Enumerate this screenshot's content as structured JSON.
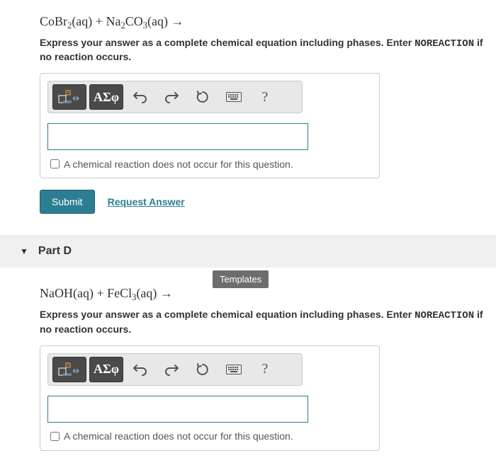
{
  "partC": {
    "equation_html": "CoBr<sub>2</sub>(aq) + Na<sub>2</sub>CO<sub>3</sub>(aq) →",
    "instruction_prefix": "Express your answer as a complete chemical equation including phases. Enter ",
    "instruction_mono": "NOREACTION",
    "instruction_suffix": " if no reaction occurs.",
    "toolbar": {
      "template_btn": "template-icon",
      "greek_label": "ΑΣφ",
      "help_label": "?"
    },
    "input_value": "",
    "checkbox_label": "A chemical reaction does not occur for this question.",
    "submit_label": "Submit",
    "request_label": "Request Answer"
  },
  "partD": {
    "header": "Part D",
    "tooltip": "Templates",
    "equation_html": "NaOH(aq) + FeCl<sub>3</sub>(aq) →",
    "instruction_prefix": "Express your answer as a complete chemical equation including phases. Enter ",
    "instruction_mono": "NOREACTION",
    "instruction_suffix": " if no reaction occurs.",
    "toolbar": {
      "greek_label": "ΑΣφ",
      "help_label": "?"
    },
    "input_value": "",
    "checkbox_label": "A chemical reaction does not occur for this question."
  }
}
